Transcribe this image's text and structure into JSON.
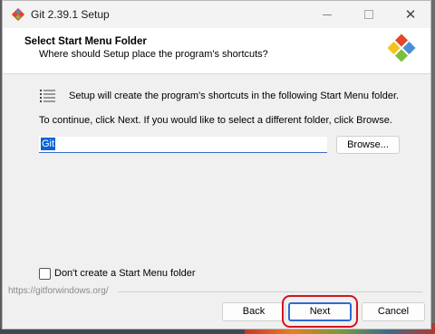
{
  "window": {
    "title": "Git 2.39.1 Setup"
  },
  "header": {
    "title": "Select Start Menu Folder",
    "subtitle": "Where should Setup place the program's shortcuts?"
  },
  "content": {
    "info_text": "Setup will create the program's shortcuts in the following Start Menu folder.",
    "instruction_text": "To continue, click Next. If you would like to select a different folder, click Browse.",
    "folder_value": "Git",
    "browse_label": "Browse...",
    "no_folder_checkbox": {
      "label": "Don't create a Start Menu folder",
      "checked": false
    }
  },
  "footer": {
    "link_text": "https://gitforwindows.org/",
    "back_label": "Back",
    "next_label": "Next",
    "cancel_label": "Cancel"
  },
  "colors": {
    "accent": "#2f6ad0",
    "highlight": "#d4141d",
    "selection": "#0a64d3"
  }
}
